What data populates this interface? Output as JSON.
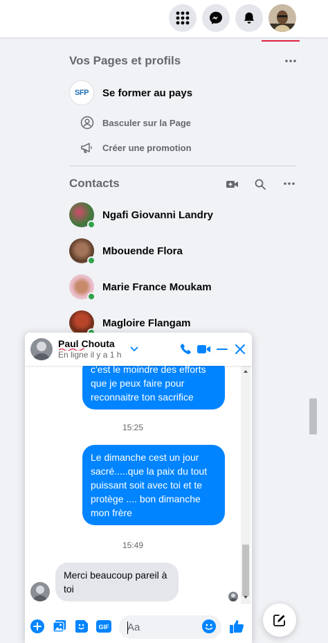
{
  "topbar": {
    "menu_icon": "grid-menu-icon",
    "messenger_icon": "messenger-icon",
    "notifications_icon": "bell-icon",
    "account_avatar": "profile-avatar"
  },
  "pages": {
    "title": "Vos Pages et profils",
    "page_name": "Se former au pays",
    "page_logo_text": "SFP",
    "switch_label": "Basculer sur la Page",
    "promo_label": "Créer une promotion"
  },
  "contacts": {
    "title": "Contacts",
    "items": [
      {
        "name": "Ngafi Giovanni Landry",
        "online": true
      },
      {
        "name": "Mbouende Flora",
        "online": true
      },
      {
        "name": "Marie France Moukam",
        "online": true
      },
      {
        "name": "Magloire Flangam",
        "online": true
      }
    ]
  },
  "chat": {
    "name": "Paul Chouta",
    "status": "En ligne il y a 1 h",
    "messages": [
      {
        "type": "out",
        "text": "c'est le moindre des efforts que je peux faire pour reconnaitre ton sacrifice"
      },
      {
        "type": "time",
        "text": "15:25"
      },
      {
        "type": "out",
        "text": "Le dimanche cest un jour sacré.....que la paix du tout puissant  soit avec toi et te protège .... bon dimanche mon frère"
      },
      {
        "type": "time",
        "text": "15:49"
      },
      {
        "type": "in",
        "text": "Merci beaucoup pareil à toi"
      }
    ],
    "input_placeholder": "Aa"
  },
  "colors": {
    "accent": "#0084ff",
    "online": "#31a24c",
    "active_tab": "#e41e3f"
  }
}
